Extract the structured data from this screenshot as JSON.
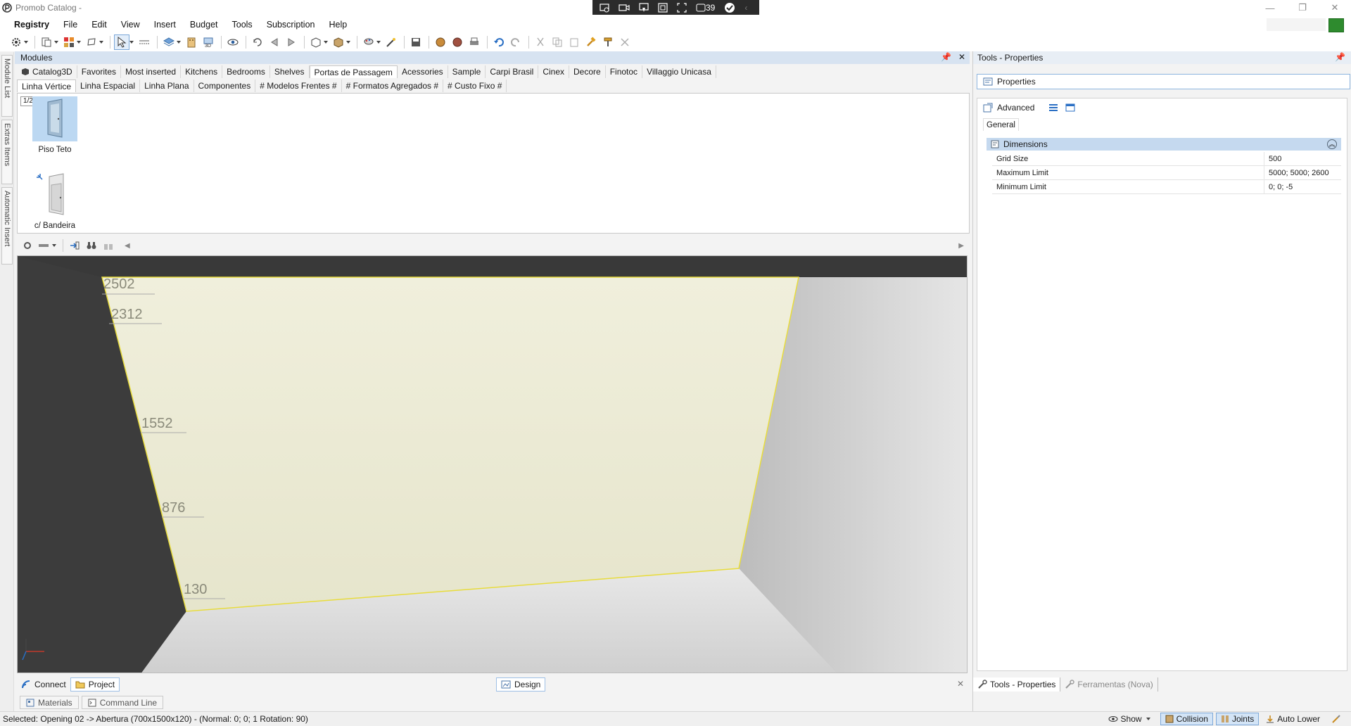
{
  "window": {
    "title": "Promob Catalog -",
    "capture_counter": "39",
    "colors": {
      "accent": "#d7e3f1",
      "selection": "#bcd8f2",
      "wall_highlight": "#ecebd4",
      "dark_wall": "#3a3a3a"
    }
  },
  "menu": {
    "items": [
      "Registry",
      "File",
      "Edit",
      "View",
      "Insert",
      "Budget",
      "Tools",
      "Subscription",
      "Help"
    ]
  },
  "left_strip": {
    "tabs": [
      "Module List",
      "Extras Items",
      "Automatic Insert"
    ]
  },
  "modules": {
    "title": "Modules",
    "tabs_row1": [
      "Catalog3D",
      "Favorites",
      "Most inserted",
      "Kitchens",
      "Bedrooms",
      "Shelves",
      "Portas de Passagem",
      "Acessories",
      "Sample",
      "Carpi Brasil",
      "Cinex",
      "Decore",
      "Finotoc",
      "Villaggio Unicasa"
    ],
    "tabs_row2": [
      "Linha Vértice",
      "Linha Espacial",
      "Linha Plana",
      "Componentes",
      "# Modelos Frentes #",
      "# Formatos Agregados #",
      "# Custo Fixo #"
    ],
    "page_indicator": "1/2",
    "items": [
      {
        "label": "Piso Teto"
      },
      {
        "label": "c/ Bandeira"
      }
    ]
  },
  "viewport": {
    "dimension_labels": [
      "2502",
      "2312",
      "1552",
      "876",
      "130"
    ]
  },
  "bottom": {
    "tabs": [
      "Connect",
      "Project"
    ],
    "design_tab": "Design",
    "sub_tabs": [
      "Materials",
      "Command Line"
    ]
  },
  "status": {
    "text": "Selected: Opening 02 -> Abertura (700x1500x120) - (Normal: 0; 0; 1 Rotation: 90)",
    "show_label": "Show",
    "collision_label": "Collision",
    "joints_label": "Joints",
    "auto_lower_label": "Auto Lower"
  },
  "properties": {
    "panel_title": "Tools - Properties",
    "tab_label": "Properties",
    "advanced_label": "Advanced",
    "general_tab": "General",
    "group_label": "Dimensions",
    "rows": [
      {
        "name": "Grid Size",
        "value": "500"
      },
      {
        "name": "Maximum Limit",
        "value": "5000; 5000; 2600"
      },
      {
        "name": "Minimum Limit",
        "value": "0; 0; -5"
      }
    ],
    "bottom_tabs": [
      "Tools - Properties",
      "Ferramentas (Nova)"
    ]
  }
}
